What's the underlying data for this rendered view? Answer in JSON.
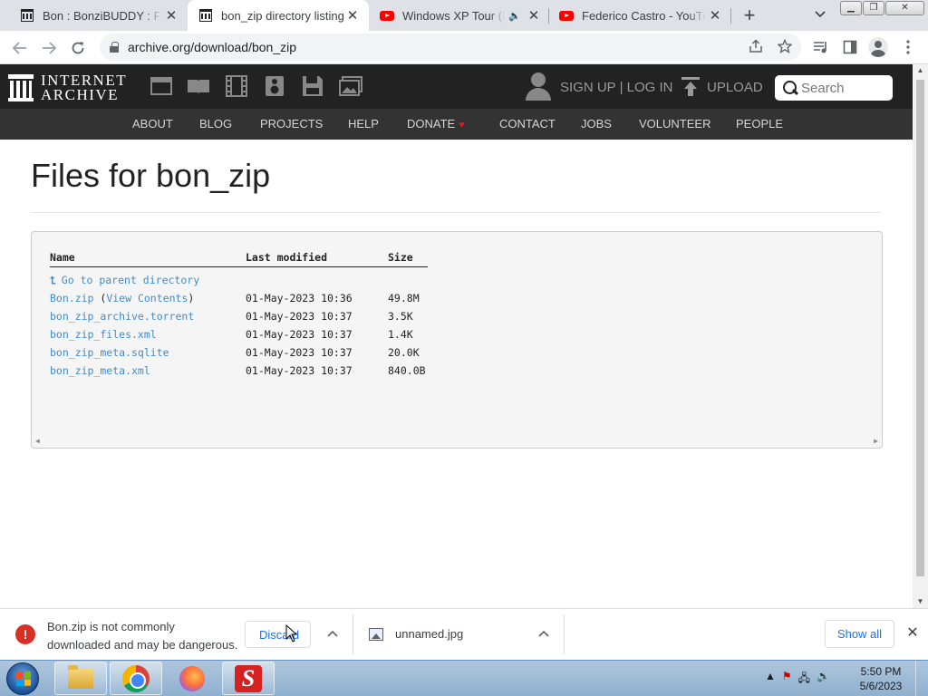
{
  "browser": {
    "tabs": [
      {
        "title": "Bon : BonziBUDDY : Free ",
        "favicon": "internet-archive-icon"
      },
      {
        "title": "bon_zip directory listing",
        "favicon": "internet-archive-icon"
      },
      {
        "title": "Windows XP Tour (Be",
        "favicon": "youtube-icon"
      },
      {
        "title": "Federico Castro - YouTub",
        "favicon": "youtube-icon"
      }
    ],
    "url": "archive.org/download/bon_zip"
  },
  "ia": {
    "logo_line1": "INTERNET",
    "logo_line2": "ARCHIVE",
    "signup": "SIGN UP | LOG IN",
    "upload": "UPLOAD",
    "search_placeholder": "Search",
    "nav": [
      "ABOUT",
      "BLOG",
      "PROJECTS",
      "HELP",
      "DONATE",
      "CONTACT",
      "JOBS",
      "VOLUNTEER",
      "PEOPLE"
    ]
  },
  "page": {
    "title": "Files for bon_zip",
    "headers": {
      "name": "Name",
      "modified": "Last modified",
      "size": "Size"
    },
    "parent_link": "Go to parent directory",
    "files": [
      {
        "name": "Bon.zip",
        "extra_open": " (",
        "extra_link": "View Contents",
        "extra_close": ")",
        "modified": "01-May-2023 10:36",
        "size": "49.8M"
      },
      {
        "name": "bon_zip_archive.torrent",
        "modified": "01-May-2023 10:37",
        "size": "3.5K"
      },
      {
        "name": "bon_zip_files.xml",
        "modified": "01-May-2023 10:37",
        "size": "1.4K"
      },
      {
        "name": "bon_zip_meta.sqlite",
        "modified": "01-May-2023 10:37",
        "size": "20.0K"
      },
      {
        "name": "bon_zip_meta.xml",
        "modified": "01-May-2023 10:37",
        "size": "840.0B"
      }
    ]
  },
  "downloads": {
    "warning_line1": "Bon.zip is not commonly",
    "warning_line2": "downloaded and may be dangerous.",
    "discard": "Discard",
    "file2": "unnamed.jpg",
    "show_all": "Show all"
  },
  "taskbar": {
    "time": "5:50 PM",
    "date": "5/6/2023"
  },
  "colors": {
    "accent_link": "#428bca",
    "ia_header": "#222222",
    "warning": "#d93025"
  }
}
